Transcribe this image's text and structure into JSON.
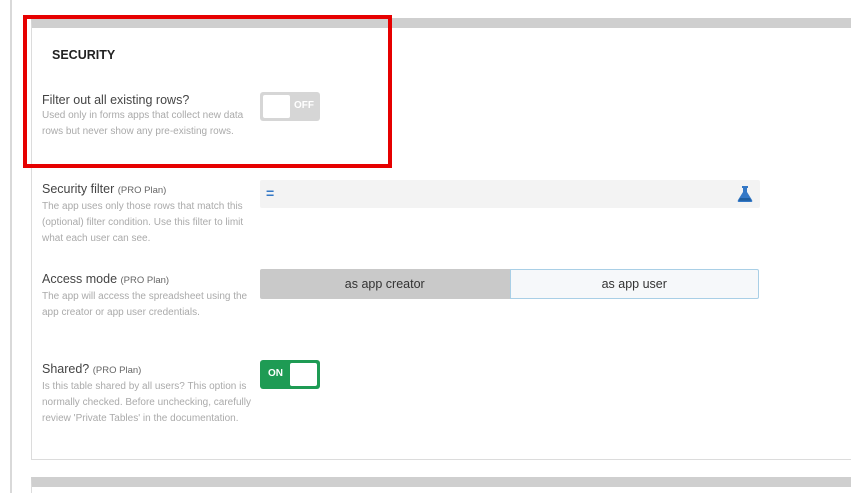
{
  "section": {
    "title": "SECURITY"
  },
  "filter_rows": {
    "label": "Filter out all existing rows?",
    "desc": "Used only in forms apps that collect new data rows but never show any pre-existing rows.",
    "toggle": {
      "state": "off",
      "label": "OFF"
    }
  },
  "security_filter": {
    "label": "Security filter",
    "pro": "(PRO Plan)",
    "desc": "The app uses only those rows that match this (optional) filter condition. Use this filter to limit what each user can see.",
    "expr_symbol": "=",
    "expr_value": "",
    "icon": "flask-icon",
    "icon_color": "#3478c6"
  },
  "access_mode": {
    "label": "Access mode",
    "pro": "(PRO Plan)",
    "desc": "The app will access the spreadsheet using the app creator or app user credentials.",
    "options": [
      "as app creator",
      "as app user"
    ],
    "selected": "as app creator"
  },
  "shared": {
    "label": "Shared?",
    "pro": "(PRO Plan)",
    "desc": "Is this table shared by all users? This option is normally checked. Before unchecking, carefully review 'Private Tables' in the documentation.",
    "toggle": {
      "state": "on",
      "label": "ON"
    }
  },
  "colors": {
    "highlight": "#e60000",
    "toggle_on": "#1e9b54",
    "toggle_off": "#d6d6d6",
    "accent": "#3478c6"
  }
}
